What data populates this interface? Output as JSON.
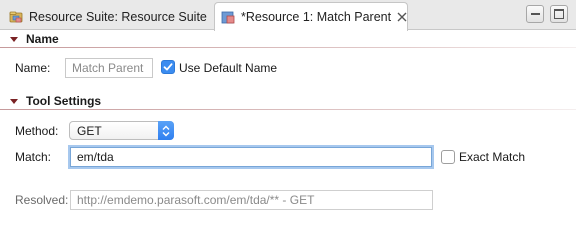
{
  "tabs": [
    {
      "label": "Resource Suite: Resource Suite",
      "active": false
    },
    {
      "label": "*Resource 1: Match Parent",
      "active": true
    }
  ],
  "sections": {
    "name": {
      "title": "Name",
      "name_label": "Name:",
      "name_value": "Match Parent",
      "use_default_label": "Use Default Name",
      "use_default_checked": true
    },
    "tool": {
      "title": "Tool Settings",
      "method_label": "Method:",
      "method_value": "GET",
      "match_label": "Match:",
      "match_value": "em/tda",
      "exact_match_label": "Exact Match",
      "exact_match_checked": false,
      "resolved_label": "Resolved:",
      "resolved_value": "http://emdemo.parasoft.com/em/tda/** - GET"
    }
  },
  "colors": {
    "accent": "#3b8cf0",
    "section_triangle": "#7a2224",
    "focus_ring": "#a7c8ee"
  },
  "icons": [
    "resource-suite-icon",
    "resource-icon",
    "close-icon",
    "minimize-icon",
    "maximize-icon",
    "check-icon",
    "select-arrows-icon"
  ]
}
